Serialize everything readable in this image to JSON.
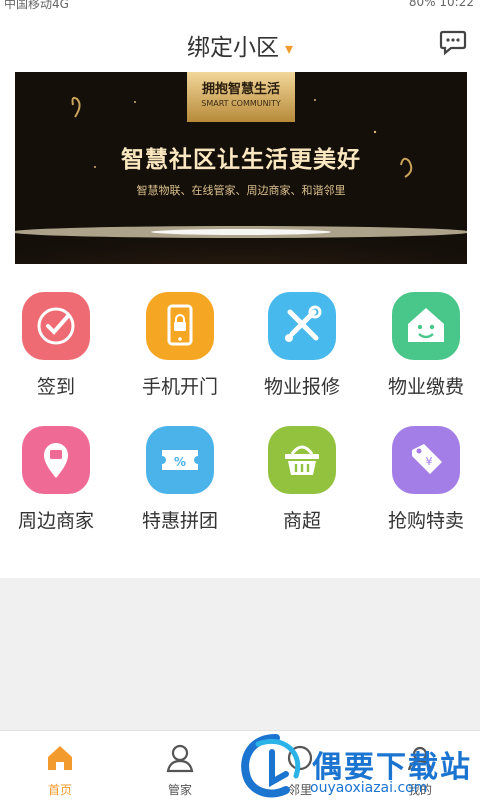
{
  "status_bar": {
    "carrier": "中国移动4G",
    "battery": "80%",
    "time": "10:22"
  },
  "header": {
    "title": "绑定小区",
    "caret": "▾",
    "message_icon": "chat-bubble-icon"
  },
  "banner": {
    "logo_cn": "拥抱智慧生活",
    "logo_en": "SMART COMMUNITY",
    "headline": "智慧社区让生活更美好",
    "tagline": "智慧物联、在线管家、周边商家、和谐邻里"
  },
  "grid": {
    "items": [
      {
        "label": "签到",
        "color": "#ef6b73",
        "icon": "check-icon"
      },
      {
        "label": "手机开门",
        "color": "#f5a623",
        "icon": "phone-lock-icon"
      },
      {
        "label": "物业报修",
        "color": "#47b9ec",
        "icon": "tools-icon"
      },
      {
        "label": "物业缴费",
        "color": "#49c68a",
        "icon": "house-face-icon"
      },
      {
        "label": "周边商家",
        "color": "#ef6b95",
        "icon": "location-pin-icon"
      },
      {
        "label": "特惠拼团",
        "color": "#4bb3ea",
        "icon": "coupon-icon"
      },
      {
        "label": "商超",
        "color": "#92c23e",
        "icon": "basket-icon"
      },
      {
        "label": "抢购特卖",
        "color": "#a37ee6",
        "icon": "price-tag-icon"
      }
    ]
  },
  "tabbar": {
    "tabs": [
      {
        "label": "首页",
        "icon": "home-icon",
        "active": true
      },
      {
        "label": "管家",
        "icon": "butler-icon",
        "active": false
      },
      {
        "label": "邻里",
        "icon": "neighbor-icon",
        "active": false
      },
      {
        "label": "我的",
        "icon": "profile-icon",
        "active": false
      }
    ]
  },
  "watermark": {
    "title": "偶要下载站",
    "url": "ouyaoxiazai.com"
  },
  "colors": {
    "accent": "#f39a2c",
    "watermark": "#1b74d0"
  }
}
